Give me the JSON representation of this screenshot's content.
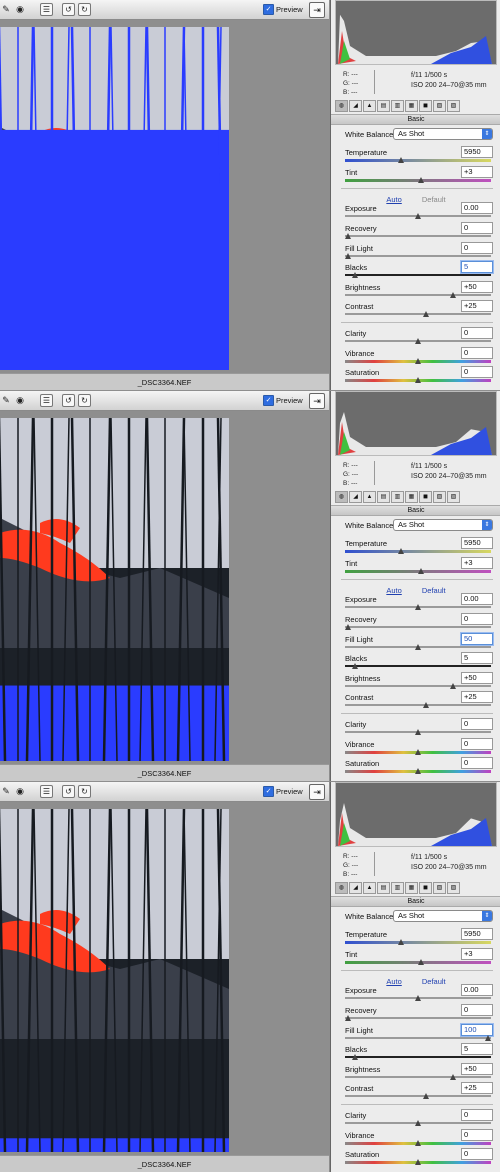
{
  "panels": [
    {
      "toolbar": {
        "preview_label": "Preview"
      },
      "filename": "_DSC3364.NEF",
      "info": {
        "r": "R:  ---",
        "g": "G:  ---",
        "b": "B:  ---",
        "aperture_shutter": "f/11   1/500 s",
        "iso_lens": "ISO 200   24–70@35 mm"
      },
      "tab_title": "Basic",
      "white_balance": {
        "label": "White Balance:",
        "value": "As Shot"
      },
      "auto_label": "Auto",
      "default_label": "Default",
      "default_enabled": false,
      "controls": [
        {
          "label": "Temperature",
          "value": "5950",
          "level": 0.38
        },
        {
          "label": "Tint",
          "value": "+3",
          "level": 0.52
        },
        {
          "label": "Exposure",
          "value": "0.00",
          "level": 0.5
        },
        {
          "label": "Recovery",
          "value": "0",
          "level": 0
        },
        {
          "label": "Fill Light",
          "value": "0",
          "level": 0
        },
        {
          "label": "Blacks",
          "value": "5",
          "level": 0.05,
          "highlight": true
        },
        {
          "label": "Brightness",
          "value": "+50",
          "level": 0.75
        },
        {
          "label": "Contrast",
          "value": "+25",
          "level": 0.56
        },
        {
          "label": "Clarity",
          "value": "0",
          "level": 0.5
        },
        {
          "label": "Vibrance",
          "value": "0",
          "level": 0.5
        },
        {
          "label": "Saturation",
          "value": "0",
          "level": 0.5
        }
      ],
      "clipping": {
        "blue_shadows": 0.7
      }
    },
    {
      "toolbar": {
        "preview_label": "Preview"
      },
      "filename": "_DSC3364.NEF",
      "info": {
        "r": "R:  ---",
        "g": "G:  ---",
        "b": "B:  ---",
        "aperture_shutter": "f/11   1/500 s",
        "iso_lens": "ISO 200   24–70@35 mm"
      },
      "tab_title": "Basic",
      "white_balance": {
        "label": "White Balance:",
        "value": "As Shot"
      },
      "auto_label": "Auto",
      "default_label": "Default",
      "default_enabled": true,
      "controls": [
        {
          "label": "Temperature",
          "value": "5950",
          "level": 0.38
        },
        {
          "label": "Tint",
          "value": "+3",
          "level": 0.52
        },
        {
          "label": "Exposure",
          "value": "0.00",
          "level": 0.5
        },
        {
          "label": "Recovery",
          "value": "0",
          "level": 0
        },
        {
          "label": "Fill Light",
          "value": "50",
          "level": 0.5,
          "highlight": true
        },
        {
          "label": "Blacks",
          "value": "5",
          "level": 0.05
        },
        {
          "label": "Brightness",
          "value": "+50",
          "level": 0.75
        },
        {
          "label": "Contrast",
          "value": "+25",
          "level": 0.56
        },
        {
          "label": "Clarity",
          "value": "0",
          "level": 0.5
        },
        {
          "label": "Vibrance",
          "value": "0",
          "level": 0.5
        },
        {
          "label": "Saturation",
          "value": "0",
          "level": 0.5
        }
      ],
      "clipping": {
        "blue_shadows": 0.22
      }
    },
    {
      "toolbar": {
        "preview_label": "Preview"
      },
      "filename": "_DSC3364.NEF",
      "info": {
        "r": "R:  ---",
        "g": "G:  ---",
        "b": "B:  ---",
        "aperture_shutter": "f/11   1/500 s",
        "iso_lens": "ISO 200   24–70@35 mm"
      },
      "tab_title": "Basic",
      "white_balance": {
        "label": "White Balance:",
        "value": "As Shot"
      },
      "auto_label": "Auto",
      "default_label": "Default",
      "default_enabled": true,
      "controls": [
        {
          "label": "Temperature",
          "value": "5950",
          "level": 0.38
        },
        {
          "label": "Tint",
          "value": "+3",
          "level": 0.52
        },
        {
          "label": "Exposure",
          "value": "0.00",
          "level": 0.5
        },
        {
          "label": "Recovery",
          "value": "0",
          "level": 0
        },
        {
          "label": "Fill Light",
          "value": "100",
          "level": 1,
          "highlight": true
        },
        {
          "label": "Blacks",
          "value": "5",
          "level": 0.05
        },
        {
          "label": "Brightness",
          "value": "+50",
          "level": 0.75
        },
        {
          "label": "Contrast",
          "value": "+25",
          "level": 0.56
        },
        {
          "label": "Clarity",
          "value": "0",
          "level": 0.5
        },
        {
          "label": "Vibrance",
          "value": "0",
          "level": 0.5
        },
        {
          "label": "Saturation",
          "value": "0",
          "level": 0.5
        }
      ],
      "clipping": {
        "blue_shadows": 0.04
      }
    }
  ],
  "colors": {
    "clip_shadow": "#2a3cff",
    "clip_highlight": "#ff3a1e",
    "sky": "#c9ccd6",
    "trees": "#1c2128",
    "histogram_bg": "#6c6c6c"
  }
}
